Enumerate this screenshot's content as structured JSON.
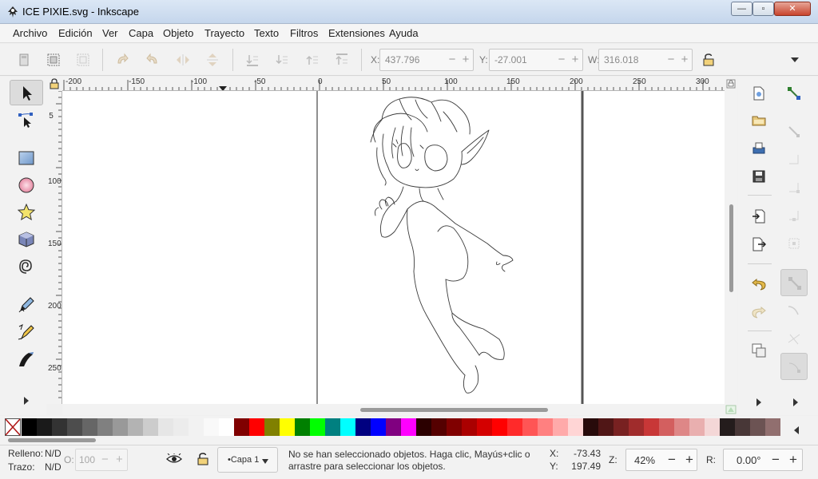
{
  "window": {
    "title": "ICE PIXIE.svg - Inkscape",
    "minimize": "—",
    "maximize": "▫",
    "close": "✕"
  },
  "menu": [
    "Archivo",
    "Edición",
    "Ver",
    "Capa",
    "Objeto",
    "Trayecto",
    "Texto",
    "Filtros",
    "Extensiones",
    "Ayuda"
  ],
  "coords_toolbar": {
    "x_label": "X:",
    "x_value": "437.796",
    "y_label": "Y:",
    "y_value": "-27.001",
    "w_label": "W:",
    "w_value": "316.018",
    "minus": "−",
    "plus": "+"
  },
  "rulers": {
    "horizontal": [
      "-200",
      "-150",
      "-100",
      "-50",
      "0",
      "50",
      "100",
      "150",
      "200",
      "250",
      "300"
    ],
    "vertical": [
      "5",
      "100",
      "150",
      "200",
      "250"
    ]
  },
  "tools": [
    "selector-tool",
    "node-tool",
    "rectangle-tool",
    "ellipse-tool",
    "star-tool",
    "3d-box-tool",
    "spiral-tool",
    "pencil-tool",
    "pen-tool",
    "calligraphy-tool"
  ],
  "palette": {
    "colors": [
      "#000000",
      "#1a1a1a",
      "#333333",
      "#4d4d4d",
      "#666666",
      "#808080",
      "#999999",
      "#b3b3b3",
      "#cccccc",
      "#e6e6e6",
      "#ececec",
      "#f2f2f2",
      "#f9f9f9",
      "#ffffff",
      "#800000",
      "#ff0000",
      "#808000",
      "#ffff00",
      "#008000",
      "#00ff00",
      "#008080",
      "#00ffff",
      "#000080",
      "#0000ff",
      "#800080",
      "#ff00ff",
      "#2b0000",
      "#550000",
      "#800000",
      "#aa0000",
      "#d40000",
      "#ff0000",
      "#ff2a2a",
      "#ff5555",
      "#ff8080",
      "#ffaaaa",
      "#ffd5d5",
      "#280b0b",
      "#501616",
      "#782121",
      "#a02c2c",
      "#c83737",
      "#d35f5f",
      "#de8787",
      "#e9afaf",
      "#f4d7d7",
      "#241c1c",
      "#483737",
      "#6c5353",
      "#916f6f"
    ]
  },
  "status": {
    "fill_label": "Relleno:",
    "fill_value": "N/D",
    "stroke_label": "Trazo:",
    "stroke_value": "N/D",
    "opacity_label": "O:",
    "opacity_value": "100",
    "layer": "•Capa 1",
    "message_line1": "No se han seleccionado objetos. Haga clic, Mayús+clic o",
    "message_line2": "arrastre para seleccionar los objetos.",
    "cursor_x_label": "X:",
    "cursor_x": "-73.43",
    "cursor_y_label": "Y:",
    "cursor_y": "197.49",
    "zoom_label": "Z:",
    "zoom_value": "42%",
    "rotation_label": "R:",
    "rotation_value": "0.00°",
    "minus": "−",
    "plus": "+"
  }
}
